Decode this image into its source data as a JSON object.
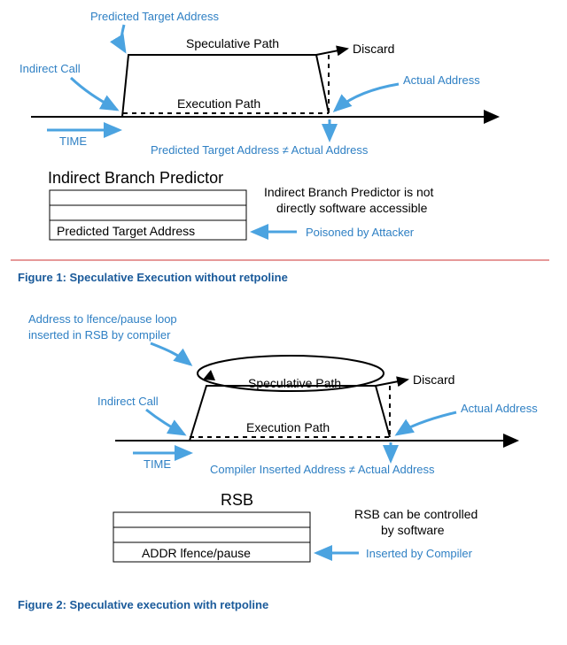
{
  "fig1": {
    "predicted_target": "Predicted Target Address",
    "speculative_path": "Speculative Path",
    "discard": "Discard",
    "indirect_call": "Indirect Call",
    "execution_path": "Execution Path",
    "actual_address": "Actual Address",
    "time": "TIME",
    "inequality": "Predicted Target Address ≠ Actual Address",
    "table_title": "Indirect Branch Predictor",
    "table_row3": "Predicted Target Address",
    "note_line1": "Indirect Branch Predictor is not",
    "note_line2": "directly software accessible",
    "poisoned": "Poisoned by Attacker",
    "caption": "Figure 1: Speculative Execution without retpoline"
  },
  "fig2": {
    "addr_line1": "Address to lfence/pause loop",
    "addr_line2": "inserted in RSB by compiler",
    "speculative_path": "Speculative Path",
    "discard": "Discard",
    "indirect_call": "Indirect Call",
    "execution_path": "Execution Path",
    "actual_address": "Actual Address",
    "time": "TIME",
    "inequality": "Compiler Inserted Address ≠ Actual Address",
    "table_title": "RSB",
    "table_row3": "ADDR lfence/pause",
    "note_line1": "RSB can be controlled",
    "note_line2": "by software",
    "inserted": "Inserted by Compiler",
    "caption": "Figure 2: Speculative execution with retpoline"
  }
}
